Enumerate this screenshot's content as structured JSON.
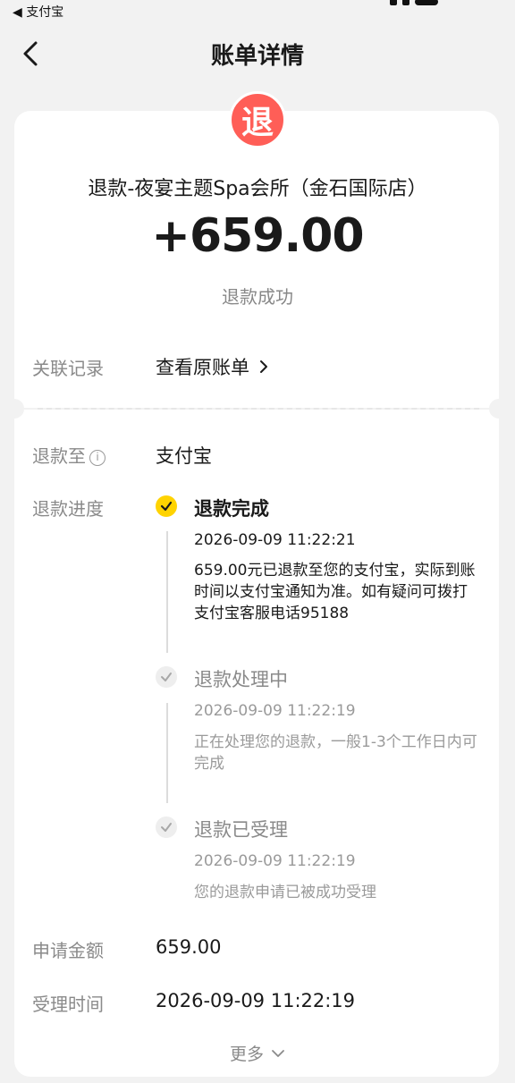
{
  "status_bar": {
    "back_app": "◀ 支付宝"
  },
  "nav": {
    "title": "账单详情"
  },
  "header": {
    "badge": "退",
    "merchant": "退款-夜宴主题Spa会所（金石国际店）",
    "amount": "+659.00",
    "status": "退款成功"
  },
  "related": {
    "label": "关联记录",
    "link": "查看原账单"
  },
  "refund_to": {
    "label": "退款至",
    "value": "支付宝"
  },
  "progress": {
    "label": "退款进度",
    "steps": [
      {
        "title": "退款完成",
        "time": "2026-09-09 11:22:21",
        "desc": "659.00元已退款至您的支付宝，实际到账时间以支付宝通知为准。如有疑问可拨打支付宝客服电话95188"
      },
      {
        "title": "退款处理中",
        "time": "2026-09-09 11:22:19",
        "desc": "正在处理您的退款，一般1-3个工作日内可完成"
      },
      {
        "title": "退款已受理",
        "time": "2026-09-09 11:22:19",
        "desc": "您的退款申请已被成功受理"
      }
    ]
  },
  "apply_amount": {
    "label": "申请金额",
    "value": "659.00"
  },
  "accept_time": {
    "label": "受理时间",
    "value": "2026-09-09 11:22:19"
  },
  "more": {
    "label": "更多"
  },
  "colors": {
    "accent_yellow": "#ffd300",
    "badge_red": "#ff5e57"
  },
  "icons": [
    "back-arrow-icon",
    "chevron-right-icon",
    "info-icon",
    "check-icon",
    "chevron-down-icon"
  ]
}
